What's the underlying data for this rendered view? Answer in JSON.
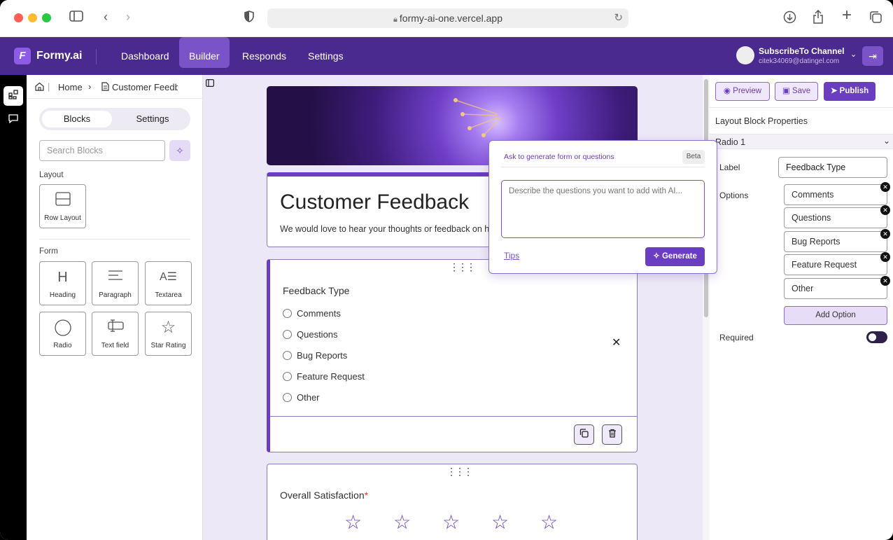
{
  "browser": {
    "url": "formy-ai-one.vercel.app"
  },
  "nav": {
    "logo_letter": "F",
    "logo_text": "Formy.ai",
    "links": [
      "Dashboard",
      "Builder",
      "Responds",
      "Settings"
    ],
    "active": "Builder",
    "user_name": "SubscribeTo Channel",
    "user_email": "citek34069@datingel.com"
  },
  "left_panel": {
    "breadcrumb_home": "Home",
    "breadcrumb_page": "Customer Feedb",
    "tabs": [
      "Blocks",
      "Settings"
    ],
    "search_placeholder": "Search Blocks",
    "layout_section": "Layout",
    "layout_blocks": [
      "Row Layout"
    ],
    "form_section": "Form",
    "form_blocks": [
      "Heading",
      "Paragraph",
      "Textarea",
      "Radio",
      "Text field",
      "Star Rating"
    ]
  },
  "form": {
    "title": "Customer Feedback",
    "description": "We would love to hear your thoughts or feedback on ho",
    "radio_question": "Feedback Type",
    "radio_options": [
      "Comments",
      "Questions",
      "Bug Reports",
      "Feature Request",
      "Other"
    ],
    "rating_question": "Overall Satisfaction",
    "rating_required_mark": "*",
    "stars": 5
  },
  "ai_popup": {
    "heading": "Ask to generate form or questions",
    "badge": "Beta",
    "placeholder": "Describe the questions you want to add with AI...",
    "tips": "Tips",
    "generate": "Generate"
  },
  "right_panel": {
    "preview": "Preview",
    "save": "Save",
    "publish": "Publish",
    "section_title": "Layout Block Properties",
    "block_name": "Radio 1",
    "label_caption": "Label",
    "label_value": "Feedback Type",
    "options_caption": "Options",
    "options": [
      "Comments",
      "Questions",
      "Bug Reports",
      "Feature Request",
      "Other"
    ],
    "add_option": "Add Option",
    "required_caption": "Required",
    "required": false
  },
  "colors": {
    "brand": "#4b2a8f",
    "accent": "#6a3dc1",
    "canvas": "#ede8f7"
  },
  "icons": [
    "layout-icon",
    "chat-icon",
    "home-icon",
    "document-icon",
    "sparkle-icon",
    "sidebar-toggle-icon",
    "drag-handle-icon",
    "close-icon",
    "copy-icon",
    "trash-icon",
    "star-icon",
    "eye-icon",
    "save-icon",
    "send-icon",
    "chevron-down-icon",
    "logout-icon"
  ]
}
